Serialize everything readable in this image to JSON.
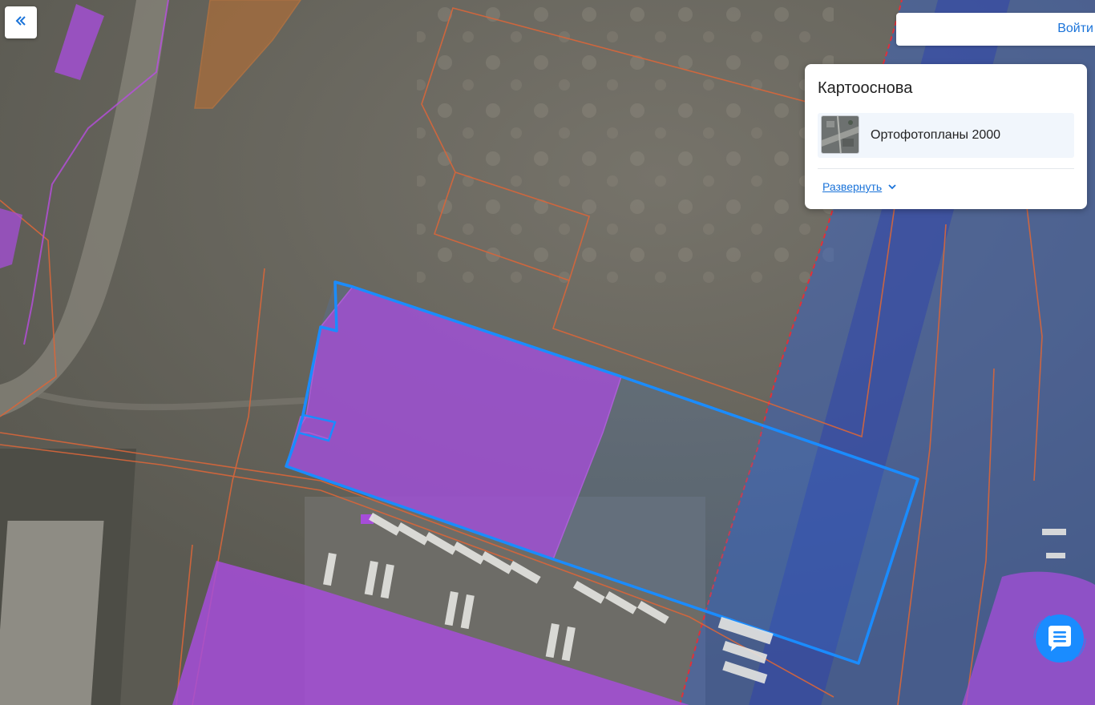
{
  "toolbar": {
    "collapse_icon": "double-chevron-left-icon",
    "login_label": "Войти"
  },
  "basemap_panel": {
    "title": "Картооснова",
    "selected_layer": {
      "name": "Ортофотопланы 2000",
      "thumbnail_icon": "orthophoto-thumbnail"
    },
    "expand_label": "Развернуть",
    "expand_icon": "chevron-down-icon"
  },
  "chat": {
    "icon": "chat-bubble-icon"
  },
  "colors": {
    "accent": "#1a73d9",
    "selected_parcel_outline": "#1a8cff",
    "zone_purple": "#a64dd9",
    "cadastral_lines": "#d9663a",
    "water_zone": "#2f5fd0"
  }
}
